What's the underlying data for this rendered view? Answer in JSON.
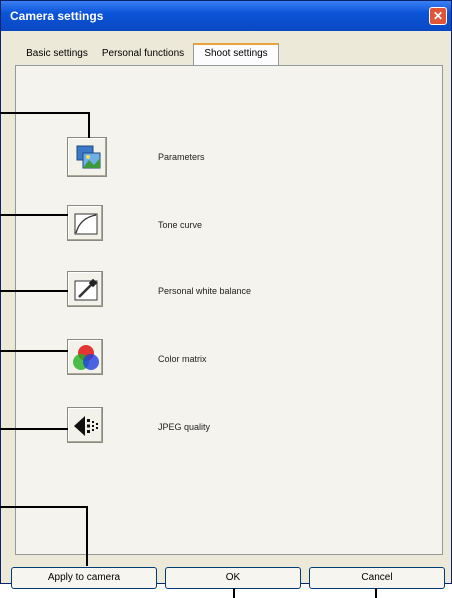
{
  "window": {
    "title": "Camera settings",
    "close_symbol": "✕"
  },
  "tabs": [
    {
      "label": "Basic settings"
    },
    {
      "label": "Personal functions"
    },
    {
      "label": "Shoot settings",
      "active": true
    }
  ],
  "items": [
    {
      "label": "Parameters",
      "icon": "parameters-icon"
    },
    {
      "label": "Tone curve",
      "icon": "tone-curve-icon"
    },
    {
      "label": "Personal white balance",
      "icon": "eyedropper-icon"
    },
    {
      "label": "Color matrix",
      "icon": "color-matrix-icon"
    },
    {
      "label": "JPEG quality",
      "icon": "jpeg-quality-icon"
    }
  ],
  "buttons": {
    "apply": "Apply to camera",
    "ok": "OK",
    "cancel": "Cancel"
  }
}
